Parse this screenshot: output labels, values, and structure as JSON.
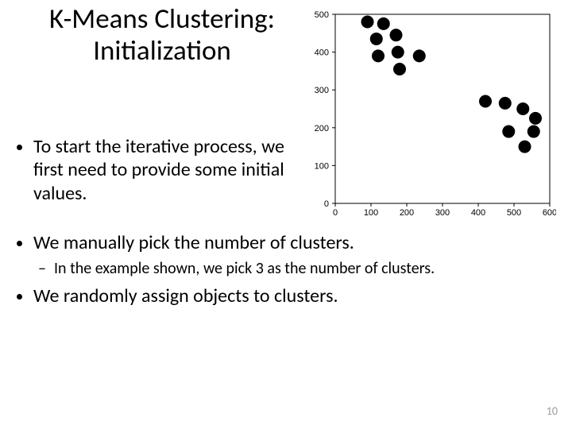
{
  "title": "K-Means Clustering: Initialization",
  "bullets": {
    "b1": "To start the iterative process, we first need to provide some initial values.",
    "b2": "We manually pick the number of clusters.",
    "b2_sub": "In the example shown, we pick 3 as the number of clusters.",
    "b3": "We randomly assign objects to clusters."
  },
  "pagenum": "10",
  "chart_data": {
    "type": "scatter",
    "title": "",
    "xlabel": "",
    "ylabel": "",
    "xlim": [
      0,
      600
    ],
    "ylim": [
      0,
      500
    ],
    "xticks": [
      0,
      100,
      200,
      300,
      400,
      500,
      600
    ],
    "yticks": [
      0,
      100,
      200,
      300,
      400,
      500
    ],
    "series": [
      {
        "name": "points",
        "color": "#000000",
        "marker": "circle",
        "x": [
          90,
          115,
          135,
          170,
          120,
          175,
          180,
          235,
          420,
          475,
          525,
          560,
          485,
          555,
          530
        ],
        "y": [
          480,
          435,
          475,
          445,
          390,
          400,
          355,
          390,
          270,
          265,
          250,
          225,
          190,
          190,
          150
        ]
      }
    ]
  }
}
